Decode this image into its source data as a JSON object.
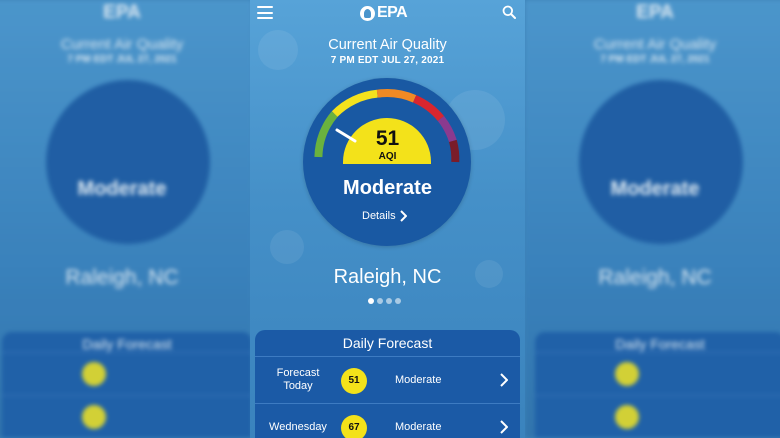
{
  "header": {
    "logo_text": "EPA"
  },
  "air_quality": {
    "title": "Current Air Quality",
    "date": "7 PM EDT  JUL 27, 2021",
    "aqi_value": "51",
    "aqi_unit": "AQI",
    "status": "Moderate",
    "details_label": "Details"
  },
  "location": {
    "city": "Raleigh, NC"
  },
  "pager": {
    "count": 4,
    "active_index": 0
  },
  "forecast": {
    "heading": "Daily Forecast",
    "rows": [
      {
        "day": "Forecast Today",
        "aqi": "51",
        "status": "Moderate"
      },
      {
        "day": "Wednesday",
        "aqi": "67",
        "status": "Moderate"
      }
    ]
  },
  "colors": {
    "aqi_moderate": "#f3e21a",
    "circle": "#1959a3",
    "forecast_panel": "#1b5aa6",
    "gauge_green": "#6ab23e",
    "gauge_yellow": "#f4e21d",
    "gauge_orange": "#f08a24",
    "gauge_red": "#d8262f",
    "gauge_purple": "#8b3a8f",
    "gauge_maroon": "#7a1c2a"
  },
  "icons": {
    "menu": "menu-icon",
    "search": "search-icon",
    "details_chevron": "chevron-right-icon",
    "row_chevron": "chevron-right-icon"
  }
}
